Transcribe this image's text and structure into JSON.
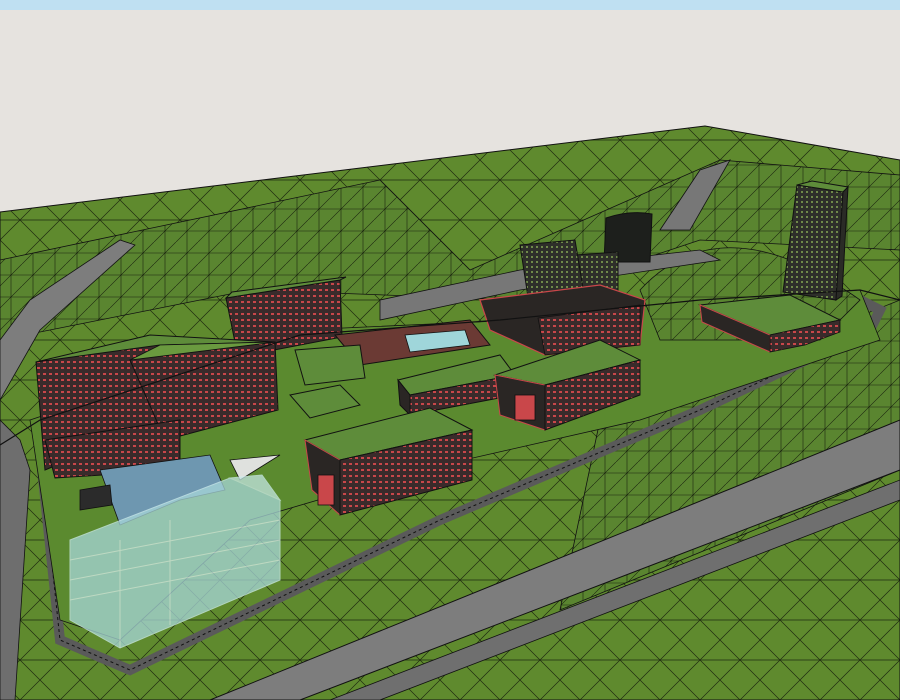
{
  "scene": {
    "kind": "3d-wireframe-site-model",
    "description_visible_text": "",
    "colors": {
      "sky_top": "#bfe0f2",
      "sky": "#e6e3df",
      "grass": "#5f8a2e",
      "grass_dark": "#3e5f1f",
      "road": "#7d7d7d",
      "road_dark": "#5a5a5a",
      "building_red": "#c9474a",
      "building_dark": "#3a2b2b",
      "roof_green": "#5e8c3a",
      "glass": "#9fd6da",
      "water": "#7fa9b8",
      "line": "#111111"
    }
  }
}
